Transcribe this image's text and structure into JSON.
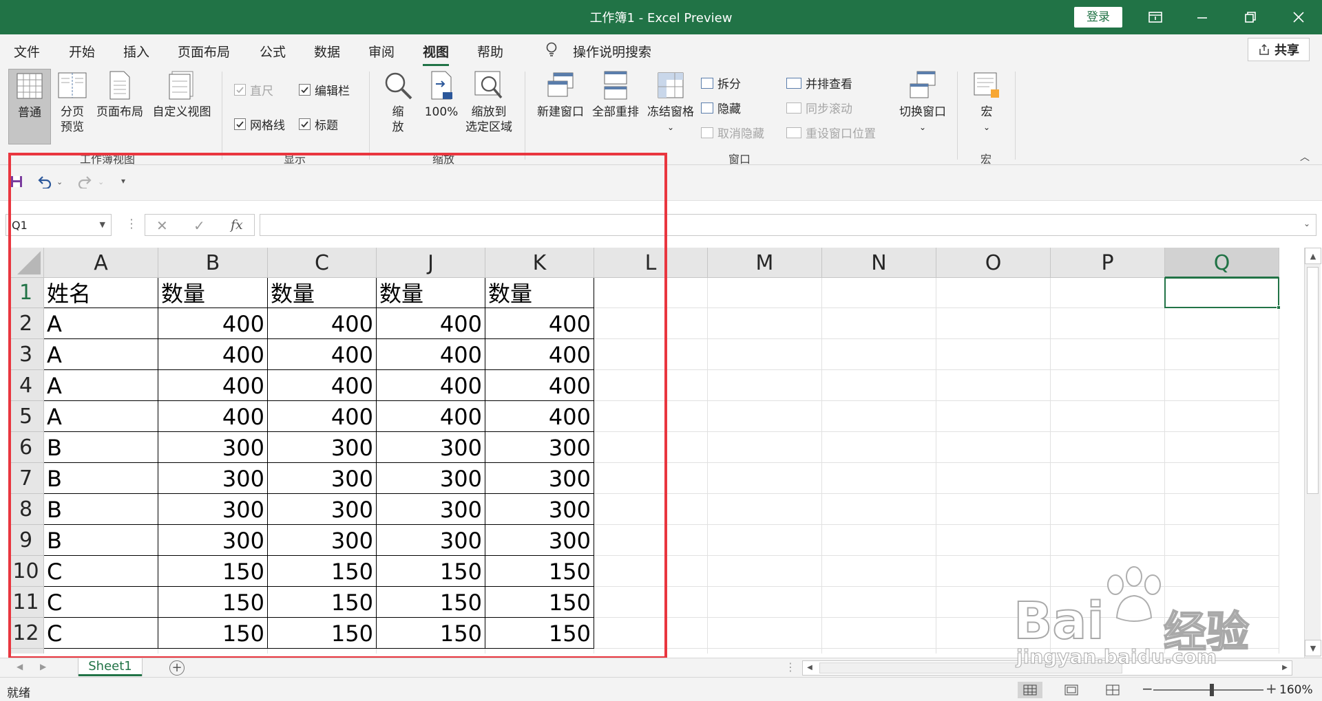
{
  "window": {
    "title": "工作簿1 - Excel Preview",
    "login_label": "登录"
  },
  "menu": {
    "tabs": [
      "文件",
      "开始",
      "插入",
      "页面布局",
      "公式",
      "数据",
      "审阅",
      "视图",
      "帮助"
    ],
    "active": "视图",
    "search_label": "操作说明搜索",
    "share_label": "共享"
  },
  "ribbon": {
    "normal_label": "普通",
    "page_break_label_1": "分页",
    "page_break_label_2": "预览",
    "page_layout_label": "页面布局",
    "custom_view_label": "自定义视图",
    "workbook_views_group": "工作簿视图",
    "ruler_label": "直尺",
    "formula_bar_label": "编辑栏",
    "gridlines_label": "网格线",
    "headings_label": "标题",
    "show_group": "显示",
    "zoom_label_1": "缩",
    "zoom_label_2": "放",
    "zoom100_label": "100%",
    "zoom_sel_label_1": "缩放到",
    "zoom_sel_label_2": "选定区域",
    "zoom_group": "缩放",
    "new_window_label": "新建窗口",
    "arrange_all_label": "全部重排",
    "freeze_panes_label": "冻结窗格",
    "split_label": "拆分",
    "hide_label": "隐藏",
    "unhide_label": "取消隐藏",
    "side_by_side_label": "并排查看",
    "sync_scroll_label": "同步滚动",
    "reset_position_label": "重设窗口位置",
    "window_group": "窗口",
    "switch_windows_label": "切换窗口",
    "macros_label": "宏",
    "macros_group": "宏"
  },
  "formula_bar": {
    "name_box": "Q1",
    "fx_label": "fx",
    "formula_value": ""
  },
  "grid": {
    "columns": [
      "A",
      "B",
      "C",
      "J",
      "K",
      "L",
      "M",
      "N",
      "O",
      "P",
      "Q"
    ],
    "selected_column": "Q",
    "rows": [
      [
        "姓名",
        "数量",
        "数量",
        "数量",
        "数量"
      ],
      [
        "A",
        "400",
        "400",
        "400",
        "400"
      ],
      [
        "A",
        "400",
        "400",
        "400",
        "400"
      ],
      [
        "A",
        "400",
        "400",
        "400",
        "400"
      ],
      [
        "A",
        "400",
        "400",
        "400",
        "400"
      ],
      [
        "B",
        "300",
        "300",
        "300",
        "300"
      ],
      [
        "B",
        "300",
        "300",
        "300",
        "300"
      ],
      [
        "B",
        "300",
        "300",
        "300",
        "300"
      ],
      [
        "B",
        "300",
        "300",
        "300",
        "300"
      ],
      [
        "C",
        "150",
        "150",
        "150",
        "150"
      ],
      [
        "C",
        "150",
        "150",
        "150",
        "150"
      ],
      [
        "C",
        "150",
        "150",
        "150",
        "150"
      ]
    ],
    "row_numbers": [
      "1",
      "2",
      "3",
      "4",
      "5",
      "6",
      "7",
      "8",
      "9",
      "10",
      "11",
      "12"
    ]
  },
  "sheets": {
    "tabs": [
      "Sheet1"
    ],
    "active": "Sheet1"
  },
  "status": {
    "ready_label": "就绪",
    "zoom_percent": "160%"
  },
  "colors": {
    "accent": "#217346",
    "highlight": "#e9363f"
  },
  "watermark": {
    "brand": "Bai",
    "brand_suffix": "经验",
    "url": "jingyan.baidu.com"
  }
}
